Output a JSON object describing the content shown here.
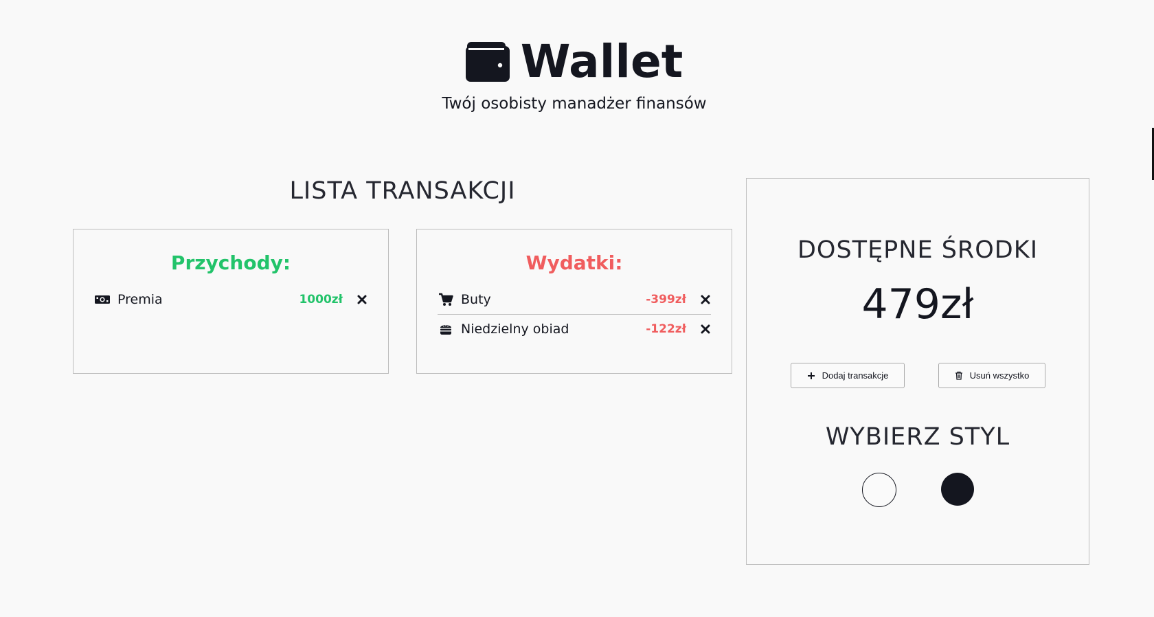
{
  "header": {
    "icon": "wallet-icon",
    "title": "Wallet",
    "subtitle": "Twój osobisty manadżer finansów"
  },
  "transactions": {
    "heading": "LISTA TRANSAKCJI",
    "income": {
      "title": "Przychody:",
      "color": "#22c36a",
      "items": [
        {
          "icon": "money-icon",
          "name": "Premia",
          "amount": "1000zł"
        }
      ]
    },
    "expenses": {
      "title": "Wydatki:",
      "color": "#f05d5e",
      "items": [
        {
          "icon": "shopping-cart-icon",
          "name": "Buty",
          "amount": "-399zł"
        },
        {
          "icon": "hamburger-icon",
          "name": "Niedzielny obiad",
          "amount": "-122zł"
        }
      ]
    }
  },
  "panel": {
    "funds_heading": "DOSTĘPNE ŚRODKI",
    "balance": "479zł",
    "add_button": "Dodaj transakcje",
    "clear_button": "Usuń wszystko",
    "style_heading": "WYBIERZ STYL",
    "styles": [
      {
        "name": "light",
        "color": "#fafafa"
      },
      {
        "name": "dark",
        "color": "#14161f"
      }
    ]
  }
}
